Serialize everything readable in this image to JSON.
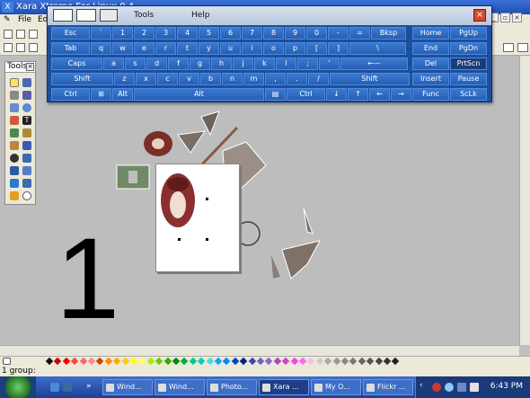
{
  "app": {
    "title": "Xara Xtreme For Linux 0.4",
    "menu": [
      "File",
      "Ed"
    ],
    "status": "1 group:"
  },
  "osk": {
    "menu_tools": "Tools",
    "menu_help": "Help",
    "close_icon": "close-icon",
    "rows": [
      [
        "Esc",
        "`",
        "1",
        "2",
        "3",
        "4",
        "5",
        "6",
        "7",
        "8",
        "9",
        "0",
        "-",
        "=",
        "Bksp",
        "Home",
        "PgUp"
      ],
      [
        "Tab",
        "q",
        "w",
        "e",
        "r",
        "t",
        "y",
        "u",
        "i",
        "o",
        "p",
        "[",
        "]",
        "\\",
        "End",
        "PgDn"
      ],
      [
        "Caps",
        "a",
        "s",
        "d",
        "f",
        "g",
        "h",
        "j",
        "k",
        "l",
        ";",
        "'",
        "←—",
        "Del",
        "PrtScn"
      ],
      [
        "Shift",
        "z",
        "x",
        "c",
        "v",
        "b",
        "n",
        "m",
        ",",
        ".",
        "/",
        "Shift",
        "Insert",
        "Pause"
      ],
      [
        "Ctrl",
        "⊞",
        "Alt",
        "Alt",
        "▤",
        "Ctrl",
        "↓",
        "↑",
        "←",
        "→",
        "Func",
        "ScLk"
      ]
    ],
    "active_key": "PrtScn"
  },
  "tools_panel": {
    "title": "Tools"
  },
  "canvas": {
    "big_number": "1"
  },
  "taskbar": {
    "tasks": [
      "Wind...",
      "Wind...",
      "Photo...",
      "Xara ...",
      "My O...",
      "Flickr ..."
    ],
    "active_task": "Xara ...",
    "clock": "6:43 PM"
  },
  "colors": {
    "osk_key": "#2f6cc4",
    "osk_key_active": "#1b3e78",
    "taskbar": "#2a55b0"
  }
}
